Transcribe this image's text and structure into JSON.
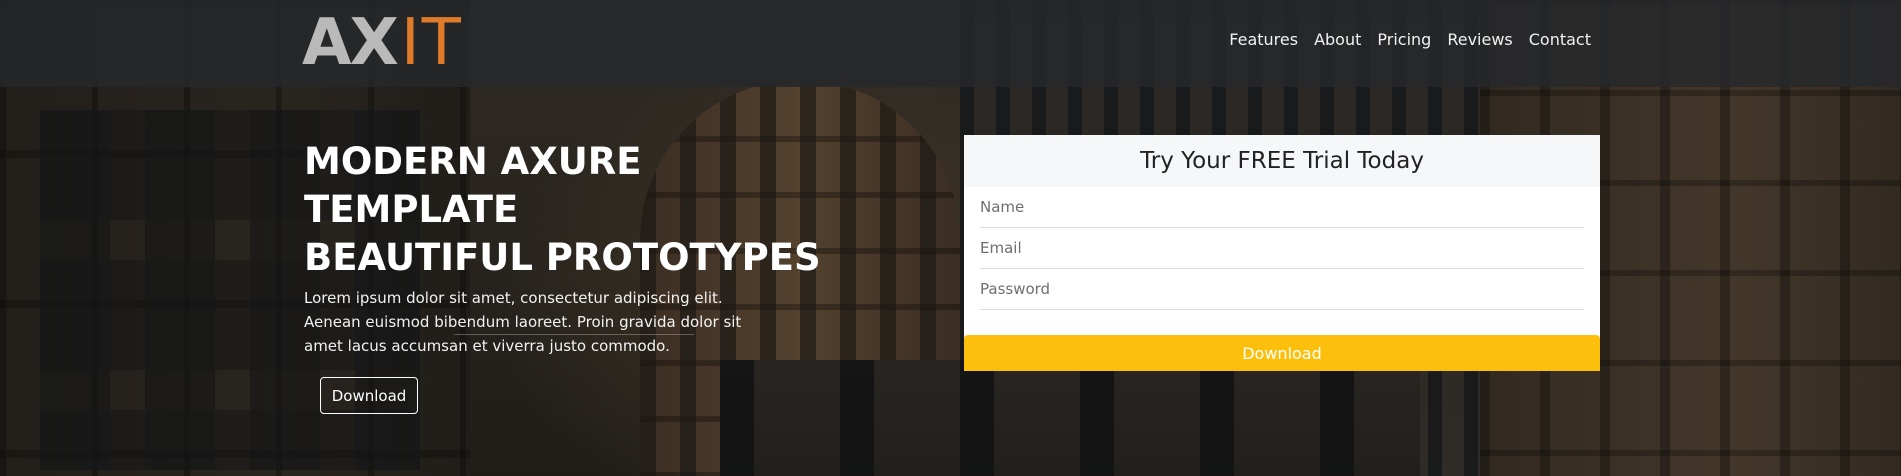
{
  "brand": {
    "logo_part1": "AX",
    "logo_part2": "IT",
    "accent_color": "#e07b2a"
  },
  "nav": {
    "items": [
      {
        "label": "Features"
      },
      {
        "label": "About"
      },
      {
        "label": "Pricing"
      },
      {
        "label": "Reviews"
      },
      {
        "label": "Contact"
      }
    ]
  },
  "hero": {
    "title_line1": "MODERN AXURE TEMPLATE",
    "title_line2": "BEAUTIFUL PROTOTYPES",
    "body": "Lorem ipsum dolor sit amet, consectetur adipiscing elit. Aenean euismod bibendum laoreet. Proin gravida dolor sit amet lacus accumsan et viverra justo commodo.",
    "button_label": "Download"
  },
  "trial_form": {
    "heading": "Try Your FREE Trial Today",
    "name_placeholder": "Name",
    "email_placeholder": "Email",
    "password_placeholder": "Password",
    "submit_label": "Download",
    "submit_color": "#fbbf0c"
  }
}
